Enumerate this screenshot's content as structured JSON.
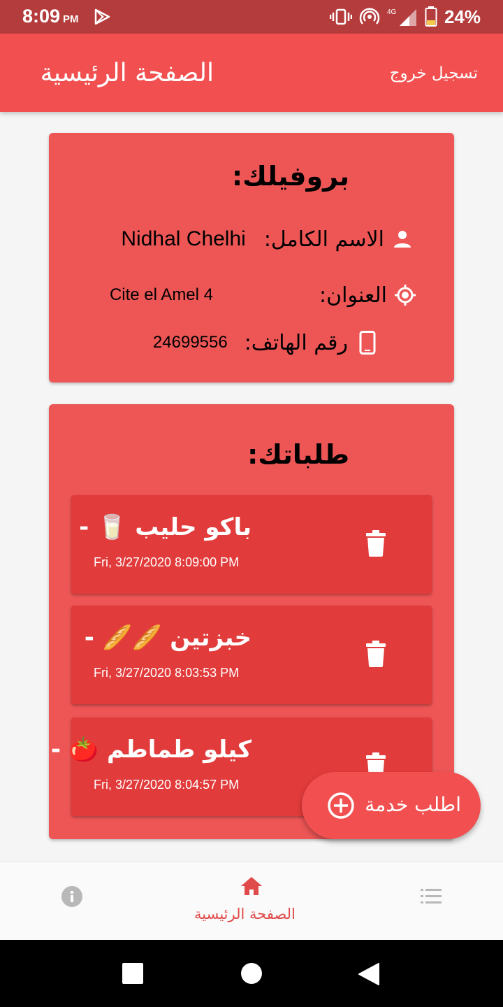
{
  "status_bar": {
    "time": "8:09",
    "ampm": "PM",
    "network": "4G",
    "battery": "24%"
  },
  "appbar": {
    "title": "الصفحة الرئيسية",
    "logout_label": "تسجيل خروج"
  },
  "profile": {
    "heading": "بروفيلك:",
    "name_label": "الاسم الكامل:",
    "name_value": "Nidhal Chelhi",
    "address_label": "العنوان:",
    "address_value": "Cite el Amel 4",
    "phone_label": "رقم الهاتف:",
    "phone_value": "24699556"
  },
  "orders": {
    "heading": "طلباتك:",
    "items": [
      {
        "title": "باكو حليب 🥛 -",
        "date": "Fri, 3/27/2020 8:09:00 PM"
      },
      {
        "title": "خبزتين 🥖🥖 -",
        "date": "Fri, 3/27/2020 8:03:53 PM"
      },
      {
        "title": "كيلو طماطم 🍅 -",
        "date": "Fri, 3/27/2020 8:04:57 PM"
      }
    ]
  },
  "fab": {
    "label": "اطلب خدمة"
  },
  "bottom_nav": {
    "home_label": "الصفحة الرئيسية",
    "icons": [
      "info-icon",
      "home-icon",
      "list-icon"
    ]
  },
  "colors": {
    "status_bar": "#b53c3c",
    "appbar": "#f25050",
    "card": "#ee5656",
    "order": "#e23b3b",
    "nav_active": "#e04a4a"
  }
}
